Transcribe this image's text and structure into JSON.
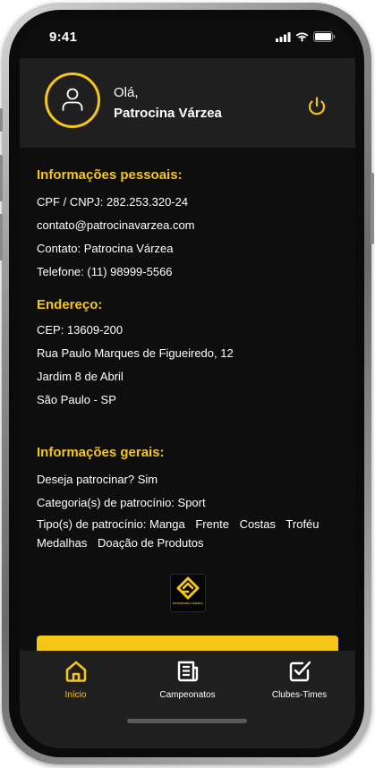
{
  "status_bar": {
    "time": "9:41"
  },
  "header": {
    "greeting": "Olá,",
    "user_name": "Patrocina Várzea"
  },
  "personal_info": {
    "title": "Informações pessoais:",
    "cpf_cnpj": "CPF / CNPJ: 282.253.320-24",
    "email": "contato@patrocinavarzea.com",
    "contact": "Contato: Patrocina Várzea",
    "phone": "Telefone: (11) 98999-5566"
  },
  "address": {
    "title": "Endereço:",
    "cep": "CEP: 13609-200",
    "street": "Rua Paulo Marques de Figueiredo, 12",
    "neighborhood": "Jardim 8 de Abril",
    "city": "São Paulo - SP"
  },
  "general_info": {
    "title": "Informações gerais:",
    "wants_sponsor": "Deseja patrocinar? Sim",
    "categories": "Categoria(s) de patrocínio: Sport",
    "types_label": "Tipo(s) de patrocínio:",
    "types": [
      "Manga",
      "Frente",
      "Costas",
      "Troféu",
      "Medalhas",
      "Doação de Produtos"
    ]
  },
  "logo": {
    "text": "PATROCINA VÁRZEA",
    "icon": "patrocina-varzea-logo"
  },
  "tabs": [
    {
      "label": "Início",
      "icon": "home-icon",
      "active": true
    },
    {
      "label": "Campeonatos",
      "icon": "newspaper-icon",
      "active": false
    },
    {
      "label": "Clubes-Times",
      "icon": "checkbox-icon",
      "active": false
    }
  ],
  "colors": {
    "accent": "#f5c518",
    "background": "#0e0e0e",
    "surface": "#1f1f1f",
    "text": "#ffffff"
  }
}
